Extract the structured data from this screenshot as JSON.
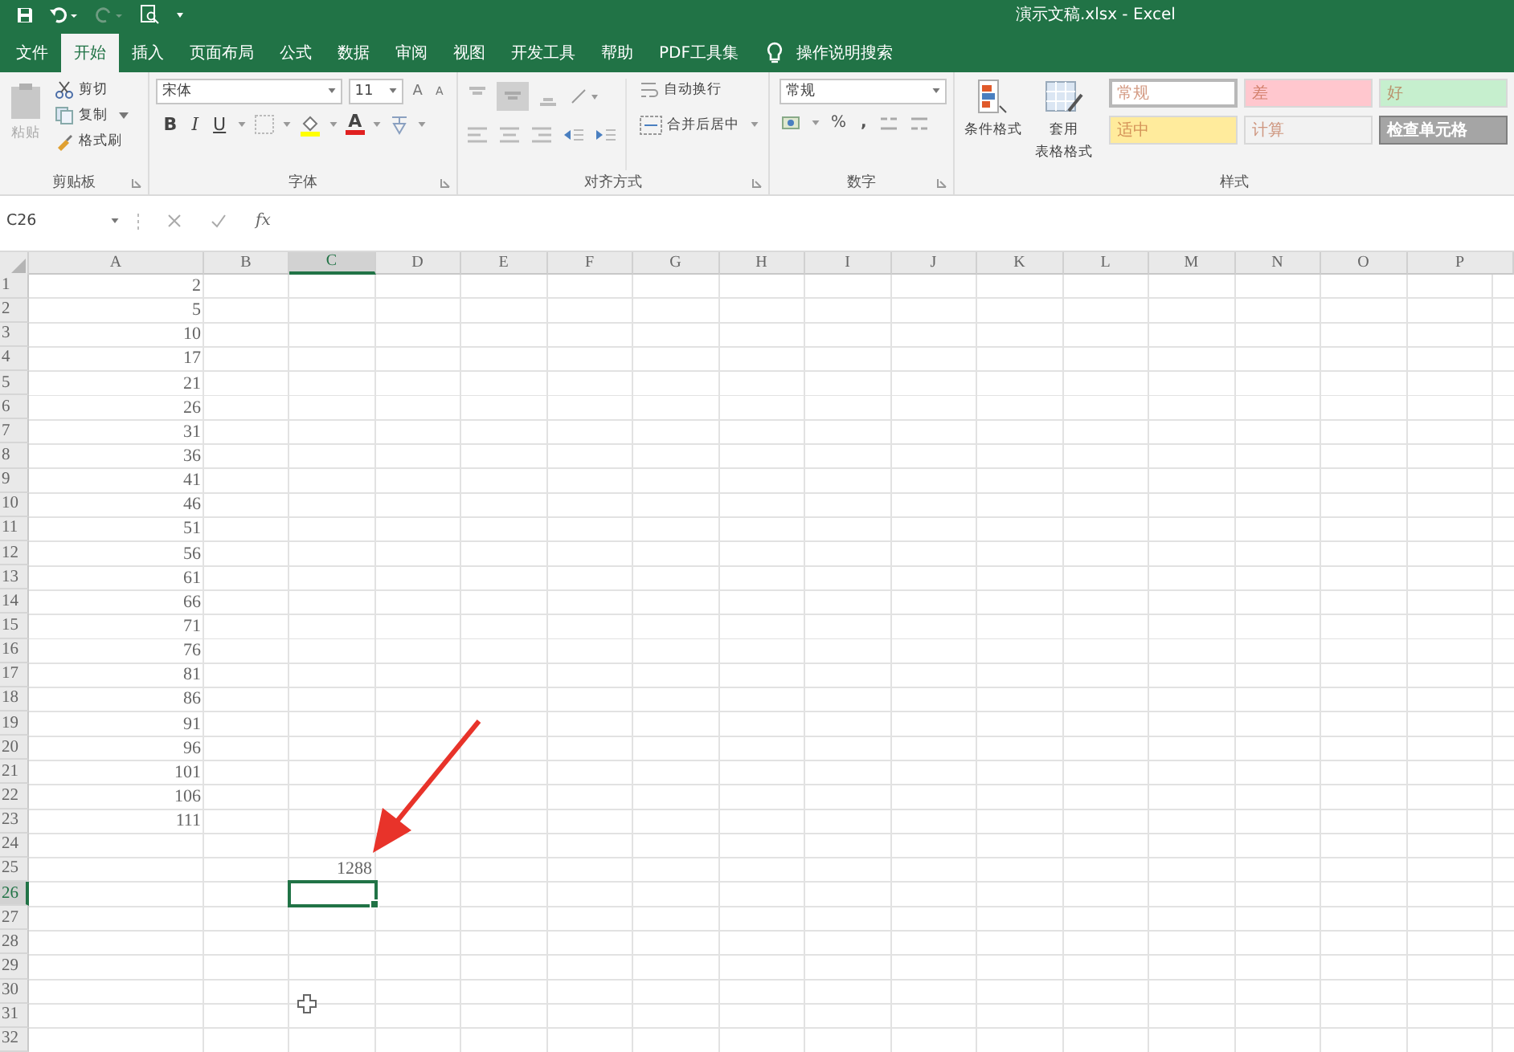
{
  "window": {
    "title": "演示文稿.xlsx  -  Excel"
  },
  "tabs": [
    {
      "label": "文件",
      "selected": false
    },
    {
      "label": "开始",
      "selected": true
    },
    {
      "label": "插入",
      "selected": false
    },
    {
      "label": "页面布局",
      "selected": false
    },
    {
      "label": "公式",
      "selected": false
    },
    {
      "label": "数据",
      "selected": false
    },
    {
      "label": "审阅",
      "selected": false
    },
    {
      "label": "视图",
      "selected": false
    },
    {
      "label": "开发工具",
      "selected": false
    },
    {
      "label": "帮助",
      "selected": false
    },
    {
      "label": "PDF工具集",
      "selected": false
    }
  ],
  "tell_me": {
    "placeholder": "操作说明搜索"
  },
  "ribbon": {
    "clipboard": {
      "label": "剪贴板",
      "paste": "粘贴",
      "cut": "剪切",
      "copy": "复制",
      "format_painter": "格式刷"
    },
    "font": {
      "label": "字体",
      "font_name": "宋体",
      "font_size": "11",
      "grow": "A",
      "shrink": "A",
      "bold": "B",
      "italic": "I",
      "underline": "U",
      "font_color": "A"
    },
    "alignment": {
      "label": "对齐方式",
      "wrap_text": "自动换行",
      "merge_center": "合并后居中"
    },
    "number": {
      "label": "数字",
      "format": "常规",
      "percent": "%",
      "comma": ","
    },
    "styles": {
      "label": "样式",
      "conditional": "条件格式",
      "table_format": [
        "套用",
        "表格格式"
      ],
      "cells": [
        {
          "label": "常规",
          "color": "#ffffff",
          "selected": true
        },
        {
          "label": "差",
          "color": "#ffc7ce",
          "selected": false
        },
        {
          "label": "好",
          "color": "#c6efce",
          "selected": false
        },
        {
          "label": "适中",
          "color": "#ffeb9c",
          "selected": false
        },
        {
          "label": "计算",
          "color": "#f2f2f2",
          "selected": false
        },
        {
          "label": "检查单元格",
          "color": "#a5a5a5",
          "selected": false
        }
      ]
    }
  },
  "formula_bar": {
    "name_box": "C26",
    "fx": "fx"
  },
  "columns": [
    {
      "label": "A",
      "selected": false
    },
    {
      "label": "B",
      "selected": false
    },
    {
      "label": "C",
      "selected": true
    },
    {
      "label": "D",
      "selected": false
    },
    {
      "label": "E",
      "selected": false
    },
    {
      "label": "F",
      "selected": false
    },
    {
      "label": "G",
      "selected": false
    },
    {
      "label": "H",
      "selected": false
    },
    {
      "label": "I",
      "selected": false
    },
    {
      "label": "J",
      "selected": false
    },
    {
      "label": "K",
      "selected": false
    },
    {
      "label": "L",
      "selected": false
    },
    {
      "label": "M",
      "selected": false
    },
    {
      "label": "N",
      "selected": false
    },
    {
      "label": "O",
      "selected": false
    },
    {
      "label": "P",
      "selected": false
    }
  ],
  "rows": [
    {
      "number": "1",
      "column_a": "2",
      "selected": false
    },
    {
      "number": "2",
      "column_a": "5",
      "selected": false
    },
    {
      "number": "3",
      "column_a": "10",
      "selected": false
    },
    {
      "number": "4",
      "column_a": "17",
      "selected": false
    },
    {
      "number": "5",
      "column_a": "21",
      "selected": false
    },
    {
      "number": "6",
      "column_a": "26",
      "selected": false
    },
    {
      "number": "7",
      "column_a": "31",
      "selected": false
    },
    {
      "number": "8",
      "column_a": "36",
      "selected": false
    },
    {
      "number": "9",
      "column_a": "41",
      "selected": false
    },
    {
      "number": "10",
      "column_a": "46",
      "selected": false
    },
    {
      "number": "11",
      "column_a": "51",
      "selected": false
    },
    {
      "number": "12",
      "column_a": "56",
      "selected": false
    },
    {
      "number": "13",
      "column_a": "61",
      "selected": false
    },
    {
      "number": "14",
      "column_a": "66",
      "selected": false
    },
    {
      "number": "15",
      "column_a": "71",
      "selected": false
    },
    {
      "number": "16",
      "column_a": "76",
      "selected": false
    },
    {
      "number": "17",
      "column_a": "81",
      "selected": false
    },
    {
      "number": "18",
      "column_a": "86",
      "selected": false
    },
    {
      "number": "19",
      "column_a": "91",
      "selected": false
    },
    {
      "number": "20",
      "column_a": "96",
      "selected": false
    },
    {
      "number": "21",
      "column_a": "101",
      "selected": false
    },
    {
      "number": "22",
      "column_a": "106",
      "selected": false
    },
    {
      "number": "23",
      "column_a": "111",
      "selected": false
    },
    {
      "number": "24",
      "selected": false
    },
    {
      "number": "25",
      "column_c": "1288",
      "selected": false
    },
    {
      "number": "26",
      "selected": true
    },
    {
      "number": "27",
      "selected": false
    },
    {
      "number": "28",
      "selected": false
    },
    {
      "number": "29",
      "selected": false
    },
    {
      "number": "30",
      "selected": false
    },
    {
      "number": "31",
      "selected": false
    },
    {
      "number": "32",
      "selected": false
    }
  ]
}
